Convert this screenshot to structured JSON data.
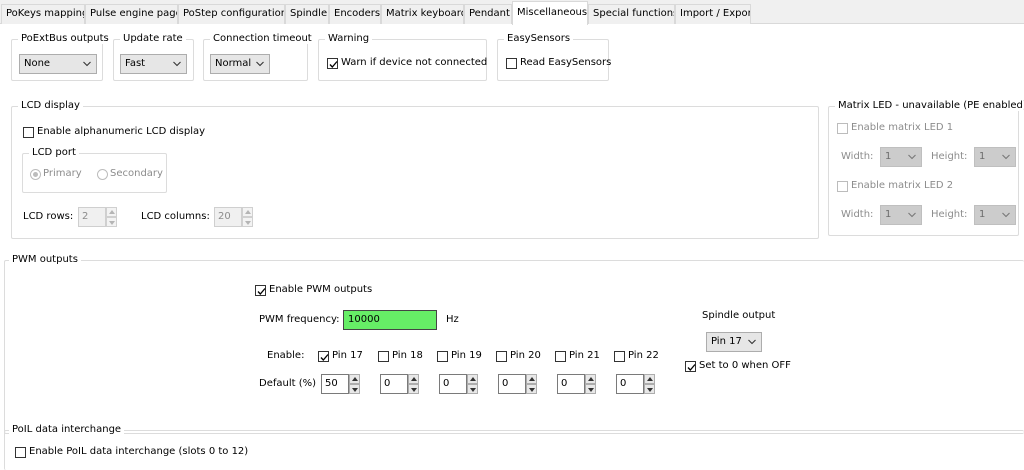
{
  "tabs": [
    "PoKeys mapping",
    "Pulse engine page",
    "PoStep configuration",
    "Spindle",
    "Encoders",
    "Matrix keyboard",
    "Pendant",
    "Miscellaneous",
    "Special functions",
    "Import / Export"
  ],
  "active_tab": "Miscellaneous",
  "poextbus": {
    "legend": "PoExtBus outputs",
    "value": "None"
  },
  "update_rate": {
    "legend": "Update rate",
    "value": "Fast"
  },
  "connection_timeout": {
    "legend": "Connection timeout",
    "value": "Normal"
  },
  "warning": {
    "legend": "Warning",
    "checkbox_label": "Warn if device not connected",
    "checked": true
  },
  "easysensors": {
    "legend": "EasySensors",
    "checkbox_label": "Read EasySensors",
    "checked": false
  },
  "lcd": {
    "legend": "LCD display",
    "enable_label": "Enable alphanumeric LCD display",
    "port_legend": "LCD port",
    "primary_label": "Primary",
    "secondary_label": "Secondary",
    "rows_label": "LCD rows:",
    "rows_value": "2",
    "columns_label": "LCD columns:",
    "columns_value": "20"
  },
  "matrix_led": {
    "legend": "Matrix LED - unavailable (PE enabled)",
    "led1_label": "Enable matrix LED 1",
    "led2_label": "Enable matrix LED 2",
    "width_label": "Width:",
    "height_label": "Height:",
    "led1_width": "1",
    "led1_height": "1",
    "led2_width": "1",
    "led2_height": "1"
  },
  "pwm": {
    "legend": "PWM outputs",
    "enable_label": "Enable PWM outputs",
    "frequency_label": "PWM frequency:",
    "frequency_value": "10000",
    "frequency_unit": "Hz",
    "enable_row_label": "Enable:",
    "default_row_label": "Default (%)",
    "pins": [
      {
        "label": "Pin 17",
        "checked": true,
        "default": "50"
      },
      {
        "label": "Pin 18",
        "checked": false,
        "default": "0"
      },
      {
        "label": "Pin 19",
        "checked": false,
        "default": "0"
      },
      {
        "label": "Pin 20",
        "checked": false,
        "default": "0"
      },
      {
        "label": "Pin 21",
        "checked": false,
        "default": "0"
      },
      {
        "label": "Pin 22",
        "checked": false,
        "default": "0"
      }
    ],
    "spindle_output_label": "Spindle output",
    "spindle_output_value": "Pin 17",
    "set_zero_label": "Set to 0 when OFF",
    "set_zero_checked": true
  },
  "poil": {
    "legend": "PoIL data interchange",
    "enable_label": "Enable PoIL data interchange (slots 0 to 12)"
  },
  "colors": {
    "frequency_bg": "#66ee66",
    "window_bg": "#f0f0f0"
  },
  "icons": {
    "dropdown": "chevron-down-icon",
    "check": "checkmark-icon",
    "spin_up": "spin-up-icon",
    "spin_down": "spin-down-icon"
  }
}
